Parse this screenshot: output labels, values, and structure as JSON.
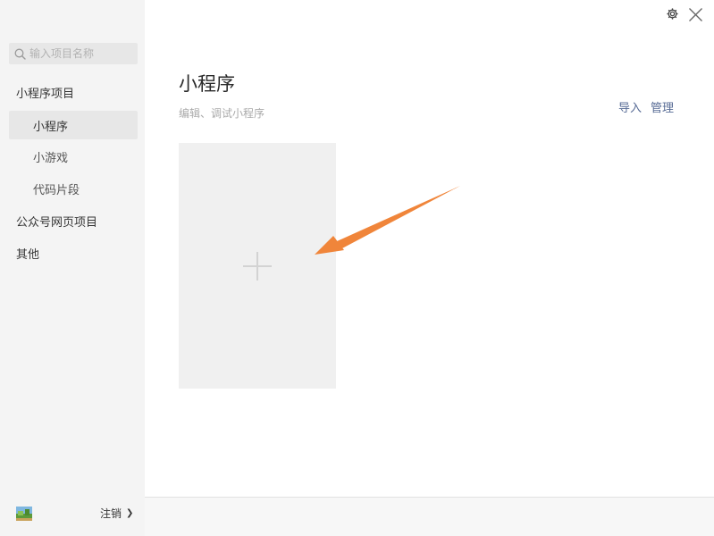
{
  "search": {
    "placeholder": "输入项目名称"
  },
  "sidebar": {
    "items": [
      {
        "label": "小程序项目"
      },
      {
        "label": "小程序"
      },
      {
        "label": "小游戏"
      },
      {
        "label": "代码片段"
      },
      {
        "label": "公众号网页项目"
      },
      {
        "label": "其他"
      }
    ],
    "active_item": "小程序"
  },
  "account": {
    "logout_label": "注销"
  },
  "main": {
    "title": "小程序",
    "subtitle": "编辑、调试小程序",
    "actions": {
      "import_label": "导入",
      "manage_label": "管理"
    }
  },
  "icons": {
    "settings": "gear-icon",
    "close": "close-icon",
    "search": "search-icon",
    "add": "plus-icon",
    "logout_chevron": "chevron-right-icon"
  },
  "colors": {
    "link": "#576b95",
    "arrow": "#f0853a",
    "sidebar_bg": "#f4f4f4",
    "card_bg": "#f0f0f0"
  }
}
